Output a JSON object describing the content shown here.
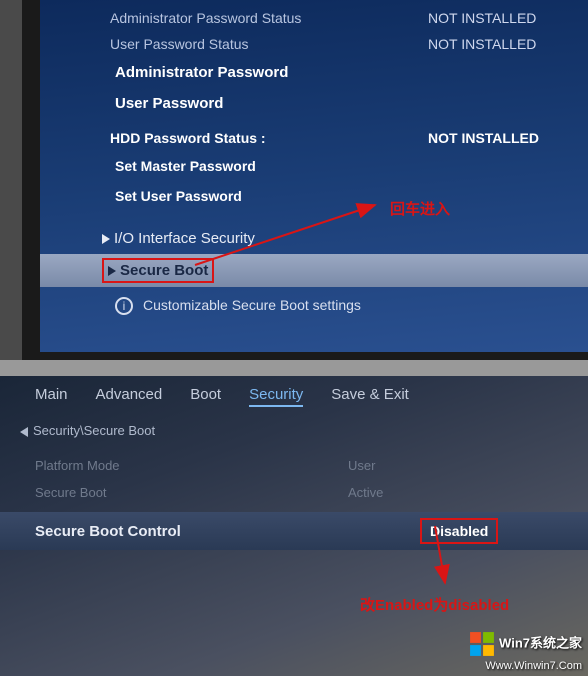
{
  "top": {
    "admin_pwd_status_label": "Administrator Password Status",
    "admin_pwd_status_value": "NOT INSTALLED",
    "user_pwd_status_label": "User Password Status",
    "user_pwd_status_value": "NOT INSTALLED",
    "admin_pwd": "Administrator Password",
    "user_pwd": "User Password",
    "hdd_status_label": "HDD Password Status  :",
    "hdd_status_value": "NOT INSTALLED",
    "set_master": "Set Master Password",
    "set_user": "Set User Password",
    "io_interface": "I/O Interface Security",
    "secure_boot": "Secure Boot",
    "info": "Customizable Secure Boot settings",
    "anno": "回车进入"
  },
  "bottom": {
    "tabs": {
      "main": "Main",
      "advanced": "Advanced",
      "boot": "Boot",
      "security": "Security",
      "save": "Save & Exit"
    },
    "breadcrumb": "Security\\Secure Boot",
    "platform_mode_label": "Platform Mode",
    "platform_mode_value": "User",
    "secure_boot_label": "Secure Boot",
    "secure_boot_value": "Active",
    "ctrl_label": "Secure Boot Control",
    "ctrl_value": "Disabled",
    "anno": "改Enabled为disabled"
  },
  "watermark": {
    "title": "Win7系统之家",
    "sub": "Www.Winwin7.Com"
  }
}
